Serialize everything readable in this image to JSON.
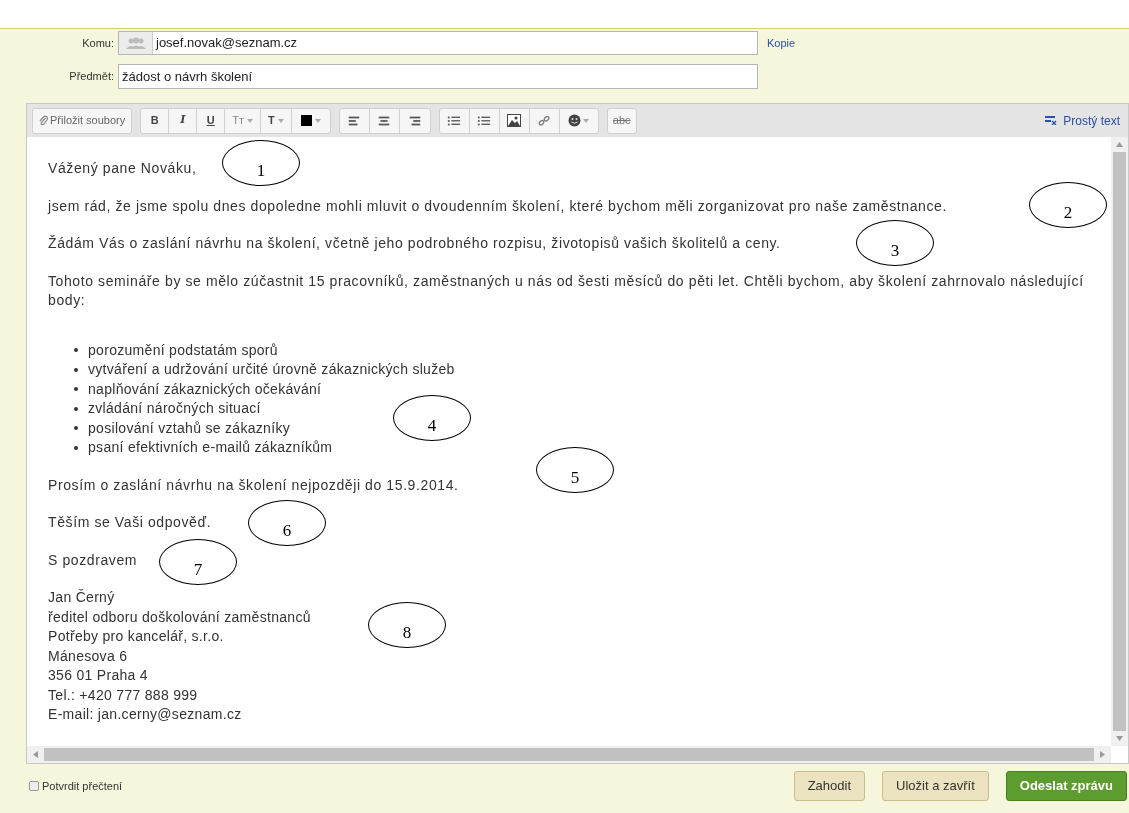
{
  "header": {
    "to_label": "Komu:",
    "to_value": "josef.novak@seznam.cz",
    "cc_link": "Kopie",
    "subject_label": "Předmět:",
    "subject_value": "žádost o návrh školení"
  },
  "toolbar": {
    "groups": [
      {
        "items": [
          {
            "kind": "attach",
            "label": "Přiložit soubory"
          }
        ]
      },
      {
        "items": [
          {
            "kind": "bold",
            "label": "B"
          },
          {
            "kind": "italic",
            "label": "I"
          },
          {
            "kind": "underline",
            "label": "U"
          },
          {
            "kind": "size",
            "label": "Tт"
          },
          {
            "kind": "font",
            "label": "T"
          },
          {
            "kind": "color",
            "color": "#000000"
          }
        ]
      },
      {
        "items": [
          {
            "kind": "align-left"
          },
          {
            "kind": "align-center"
          },
          {
            "kind": "align-right"
          }
        ]
      },
      {
        "items": [
          {
            "kind": "ordered-list"
          },
          {
            "kind": "bullet-list"
          },
          {
            "kind": "image"
          },
          {
            "kind": "link"
          },
          {
            "kind": "emoji"
          }
        ]
      },
      {
        "items": [
          {
            "kind": "spell",
            "label": "abc"
          }
        ]
      }
    ],
    "plain_text": "Prostý text"
  },
  "body": [
    {
      "kind": "para",
      "text": "Vážený pane Nováku,"
    },
    {
      "kind": "para",
      "text": "jsem rád, že jsme spolu dnes dopoledne mohli mluvit o dvoudenním školení, které bychom měli zorganizovat pro naše zaměstnance."
    },
    {
      "kind": "para",
      "text": "Žádám Vás o zaslání návrhu na školení, včetně jeho podrobného rozpisu, životopisů vašich školitelů a ceny."
    },
    {
      "kind": "para",
      "text": "Tohoto semináře by se mělo zúčastnit 15 pracovníků, zaměstnaných u nás od šesti měsíců do pěti let. Chtěli bychom, aby školení zahrnovalo následující body:"
    },
    {
      "kind": "list",
      "items": [
        "porozumění podstatám sporů",
        "vytváření a udržování určité úrovně zákaznických služeb",
        "naplňování zákaznických očekávání",
        "zvládání náročných situací",
        "posilování vztahů se zákazníky",
        "psaní efektivních e-mailů zákazníkům"
      ]
    },
    {
      "kind": "para",
      "text": "Prosím o zaslání návrhu na školení nejpozději do 15.9.2014."
    },
    {
      "kind": "para",
      "text": "Těším se Vaši odpověď."
    },
    {
      "kind": "para",
      "text": "S pozdravem"
    },
    {
      "kind": "lines",
      "items": [
        "Jan Černý",
        "ředitel odboru doškolování zaměstnanců",
        "Potřeby pro kancelář, s.r.o.",
        "Mánesova 6",
        "356 01 Praha 4",
        "Tel.: +420 777 888 999",
        "E-mail: jan.cerny@seznam.cz"
      ]
    }
  ],
  "callouts": [
    "1",
    "2",
    "3",
    "4",
    "5",
    "6",
    "7",
    "8"
  ],
  "footer": {
    "confirm_label": "Potvrdit přečtení",
    "confirm_checked": false,
    "buttons": [
      {
        "kind": "plain",
        "label": "Zahodit"
      },
      {
        "kind": "plain",
        "label": "Uložit a zavřít"
      },
      {
        "kind": "primary",
        "label": "Odeslat zprávu"
      }
    ]
  }
}
